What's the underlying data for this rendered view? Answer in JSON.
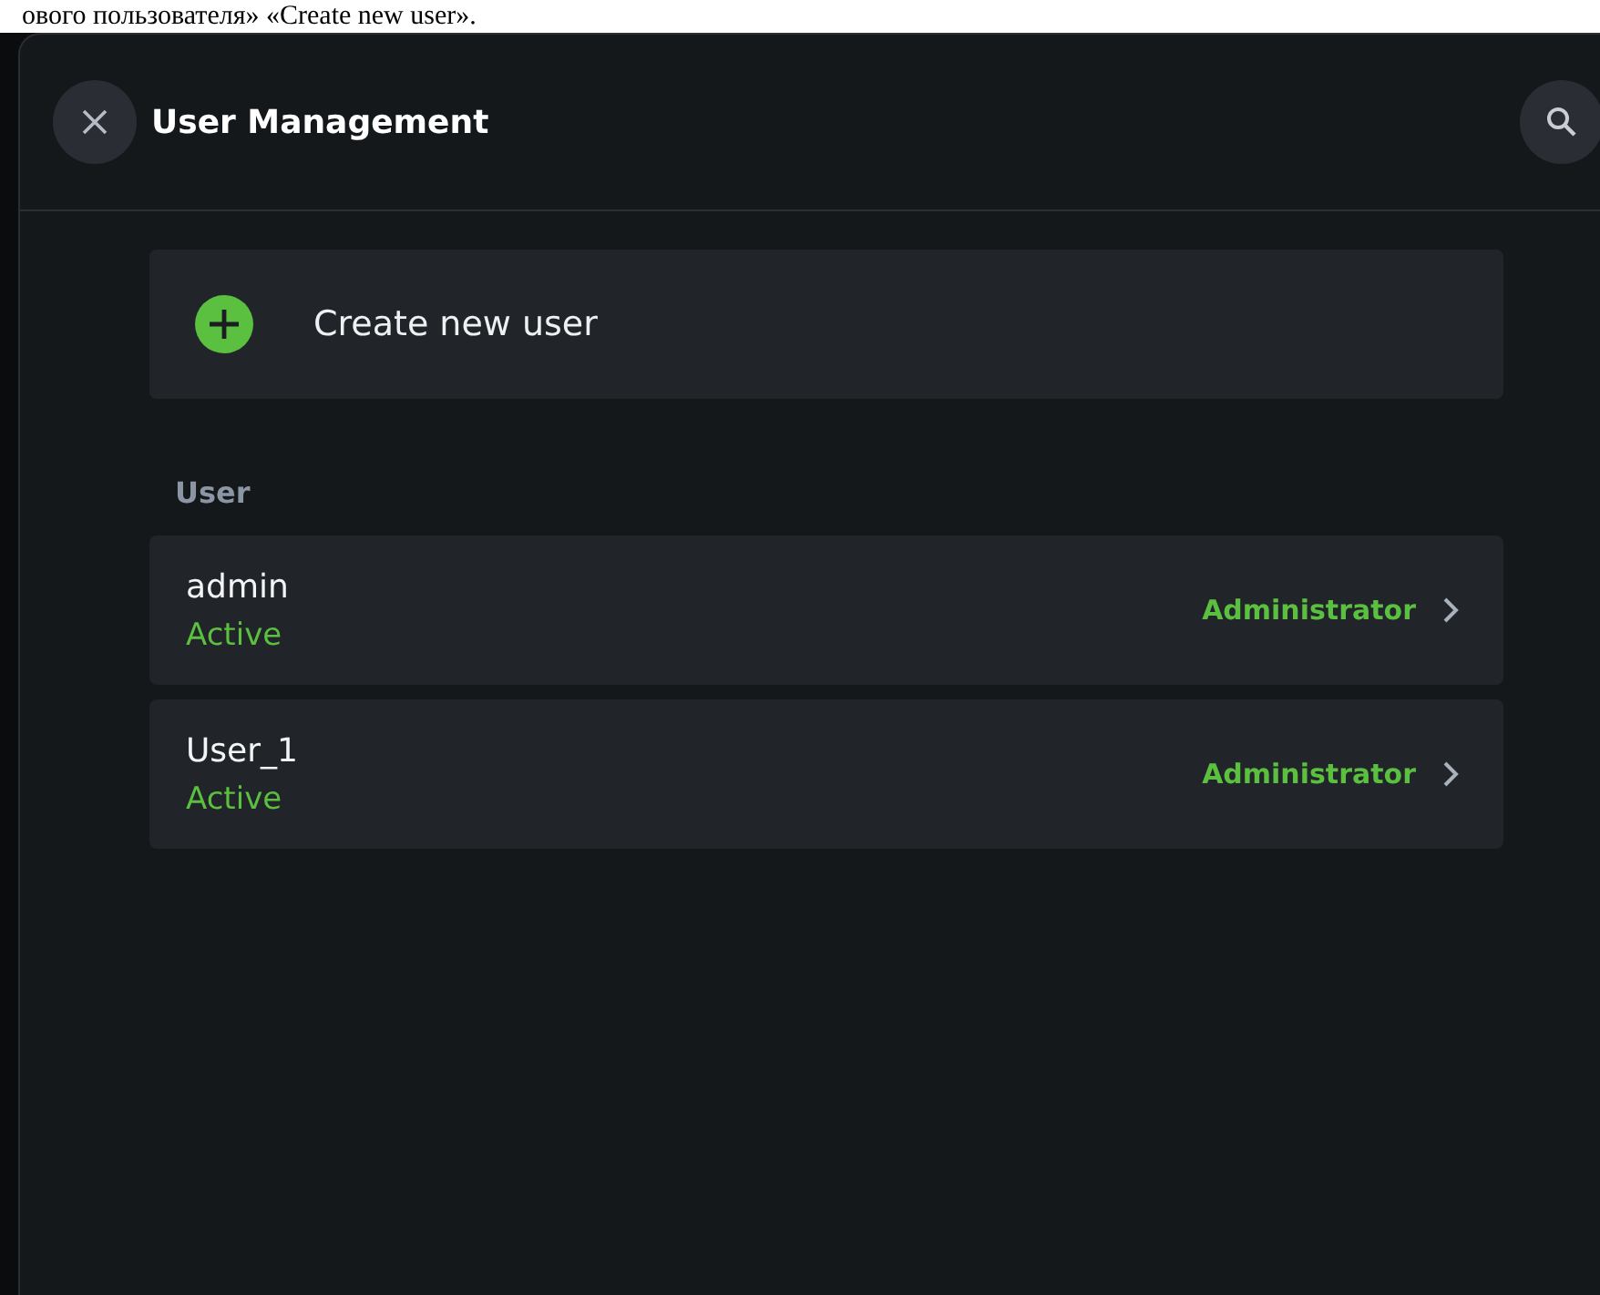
{
  "caption": "ового пользователя» «Create new user».",
  "dialog": {
    "title": "User Management",
    "create_button": {
      "label": "Create new user"
    },
    "section_label": "User",
    "users": [
      {
        "name": "admin",
        "status": "Active",
        "role": "Administrator"
      },
      {
        "name": "User_1",
        "status": "Active",
        "role": "Administrator"
      }
    ]
  }
}
